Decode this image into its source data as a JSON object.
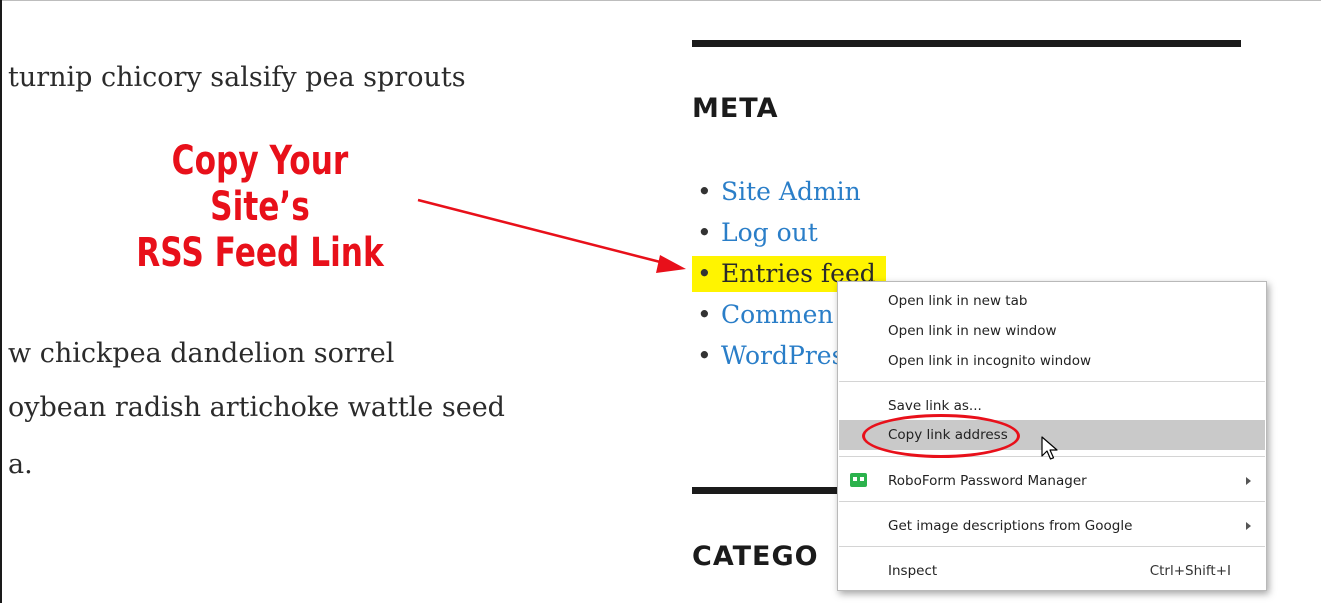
{
  "body_text": {
    "line1": "turnip chicory salsify pea sprouts",
    "line2": "w chickpea dandelion sorrel",
    "line3": "oybean radish artichoke wattle seed",
    "line4": "a."
  },
  "annotation": {
    "line1": "Copy Your Site’s",
    "line2": "RSS Feed Link",
    "color": "#e8101a"
  },
  "sidebar": {
    "meta_title": "META",
    "meta_items": [
      {
        "label": "Site Admin"
      },
      {
        "label": "Log out"
      },
      {
        "label": "Entries feed",
        "highlighted": true
      },
      {
        "label": "Commen"
      },
      {
        "label": "WordPres"
      }
    ],
    "categories_title": "CATEGO",
    "link_color": "#2a7ec8",
    "highlight_color": "#fff400"
  },
  "context_menu": {
    "items": [
      {
        "label": "Open link in new tab"
      },
      {
        "label": "Open link in new window"
      },
      {
        "label": "Open link in incognito window"
      },
      {
        "label": "Save link as..."
      },
      {
        "label": "Copy link address",
        "hovered": true
      },
      {
        "label": "RoboForm Password Manager",
        "icon": "roboform-icon",
        "submenu": true
      },
      {
        "label": "Get image descriptions from Google",
        "submenu": true
      },
      {
        "label": "Inspect",
        "shortcut": "Ctrl+Shift+I"
      }
    ]
  }
}
